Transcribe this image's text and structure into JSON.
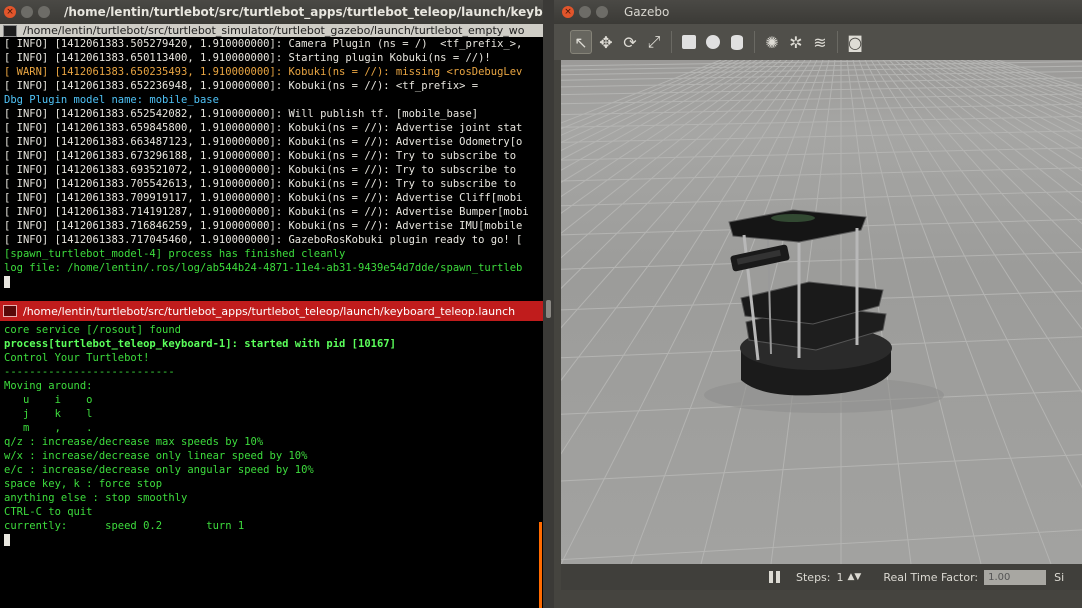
{
  "terminal1": {
    "title": "/home/lentin/turtlebot/src/turtlebot_apps/turtlebot_teleop/launch/keyboard_",
    "tab_title": "/home/lentin/turtlebot/src/turtlebot_simulator/turtlebot_gazebo/launch/turtlebot_empty_wo",
    "lines": [
      {
        "type": "info",
        "text": "[ INFO] [1412061383.505279420, 1.910000000]: Camera Plugin (ns = /)  <tf_prefix_>,"
      },
      {
        "type": "info",
        "text": "[ INFO] [1412061383.650113400, 1.910000000]: Starting plugin Kobuki(ns = //)!"
      },
      {
        "type": "warn",
        "text": "[ WARN] [1412061383.650235493, 1.910000000]: Kobuki(ns = //): missing <rosDebugLev"
      },
      {
        "type": "info",
        "text": "[ INFO] [1412061383.652236948, 1.910000000]: Kobuki(ns = //): <tf_prefix> ="
      },
      {
        "type": "dbg",
        "text": "Dbg Plugin model name: mobile_base"
      },
      {
        "type": "info",
        "text": "[ INFO] [1412061383.652542082, 1.910000000]: Will publish tf. [mobile_base]"
      },
      {
        "type": "info",
        "text": "[ INFO] [1412061383.659845800, 1.910000000]: Kobuki(ns = //): Advertise joint stat"
      },
      {
        "type": "info",
        "text": "[ INFO] [1412061383.663487123, 1.910000000]: Kobuki(ns = //): Advertise Odometry[o"
      },
      {
        "type": "info",
        "text": "[ INFO] [1412061383.673296188, 1.910000000]: Kobuki(ns = //): Try to subscribe to"
      },
      {
        "type": "info",
        "text": "[ INFO] [1412061383.693521072, 1.910000000]: Kobuki(ns = //): Try to subscribe to"
      },
      {
        "type": "info",
        "text": "[ INFO] [1412061383.705542613, 1.910000000]: Kobuki(ns = //): Try to subscribe to"
      },
      {
        "type": "info",
        "text": "[ INFO] [1412061383.709919117, 1.910000000]: Kobuki(ns = //): Advertise Cliff[mobi"
      },
      {
        "type": "info",
        "text": "[ INFO] [1412061383.714191287, 1.910000000]: Kobuki(ns = //): Advertise Bumper[mobi"
      },
      {
        "type": "info",
        "text": "[ INFO] [1412061383.716846259, 1.910000000]: Kobuki(ns = //): Advertise IMU[mobile"
      },
      {
        "type": "info",
        "text": "[ INFO] [1412061383.717045460, 1.910000000]: GazeboRosKobuki plugin ready to go! ["
      },
      {
        "type": "green",
        "text": "[spawn_turtlebot_model-4] process has finished cleanly"
      },
      {
        "type": "green",
        "text": "log file: /home/lentin/.ros/log/ab544b24-4871-11e4-ab31-9439e54d7dde/spawn_turtleb"
      }
    ]
  },
  "terminal2": {
    "tab_title": "/home/lentin/turtlebot/src/turtlebot_apps/turtlebot_teleop/launch/keyboard_teleop.launch",
    "lines": [
      {
        "type": "green",
        "text": "core service [/rosout] found"
      },
      {
        "type": "bright",
        "text": "process[turtlebot_teleop_keyboard-1]: started with pid [10167]"
      },
      {
        "type": "green",
        "text": ""
      },
      {
        "type": "green",
        "text": "Control Your Turtlebot!"
      },
      {
        "type": "green",
        "text": "---------------------------"
      },
      {
        "type": "green",
        "text": "Moving around:"
      },
      {
        "type": "green",
        "text": "   u    i    o"
      },
      {
        "type": "green",
        "text": "   j    k    l"
      },
      {
        "type": "green",
        "text": "   m    ,    ."
      },
      {
        "type": "green",
        "text": ""
      },
      {
        "type": "green",
        "text": "q/z : increase/decrease max speeds by 10%"
      },
      {
        "type": "green",
        "text": "w/x : increase/decrease only linear speed by 10%"
      },
      {
        "type": "green",
        "text": "e/c : increase/decrease only angular speed by 10%"
      },
      {
        "type": "green",
        "text": "space key, k : force stop"
      },
      {
        "type": "green",
        "text": "anything else : stop smoothly"
      },
      {
        "type": "green",
        "text": ""
      },
      {
        "type": "green",
        "text": "CTRL-C to quit"
      },
      {
        "type": "green",
        "text": ""
      },
      {
        "type": "green",
        "text": "currently:      speed 0.2       turn 1"
      }
    ]
  },
  "gazebo": {
    "title": "Gazebo",
    "toolbar": [
      {
        "name": "select-mode-icon",
        "glyph": "↖",
        "active": true
      },
      {
        "name": "translate-mode-icon",
        "glyph": "✥",
        "active": false
      },
      {
        "name": "rotate-mode-icon",
        "glyph": "⟳",
        "active": false
      },
      {
        "name": "scale-mode-icon",
        "glyph": "⤢",
        "active": false
      },
      {
        "name": "sep"
      },
      {
        "name": "box-shape-icon",
        "shape": "box"
      },
      {
        "name": "sphere-shape-icon",
        "shape": "sphere"
      },
      {
        "name": "cylinder-shape-icon",
        "shape": "cyl"
      },
      {
        "name": "sep"
      },
      {
        "name": "point-light-icon",
        "glyph": "✺",
        "active": false
      },
      {
        "name": "spot-light-icon",
        "glyph": "✲",
        "active": false
      },
      {
        "name": "directional-light-icon",
        "glyph": "≋",
        "active": false
      },
      {
        "name": "sep"
      },
      {
        "name": "screenshot-camera-icon",
        "glyph": "◙",
        "active": false
      }
    ],
    "status": {
      "steps_label": "Steps:",
      "steps_value": "1",
      "steps_arrow": "▲▼",
      "rtf_label": "Real Time Factor:",
      "rtf_value": "1.00",
      "sim_label": "Si"
    }
  }
}
